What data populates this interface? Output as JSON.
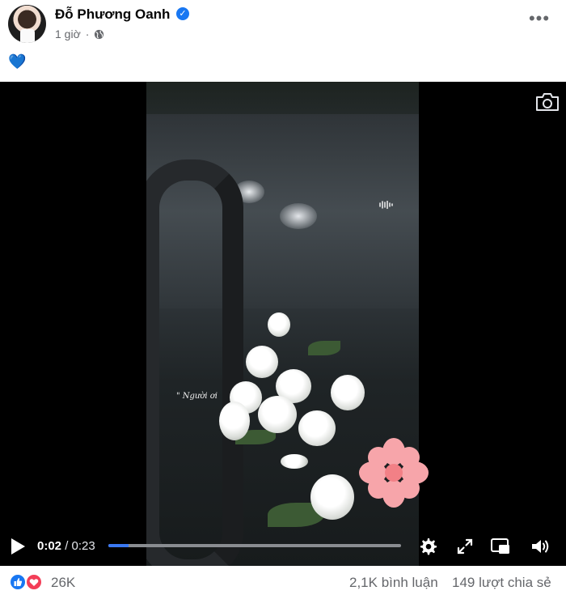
{
  "post": {
    "author": "Đỗ Phương Oanh",
    "time": "1 giờ",
    "text": "💙"
  },
  "video": {
    "overlay_text": "\" Người ơi",
    "current_time": "0:02",
    "separator": "/",
    "duration": "0:23",
    "progress": 0.068
  },
  "footer": {
    "reaction_count": "26K",
    "comments": "2,1K bình luận",
    "shares": "149 lượt chia sẻ"
  },
  "colors": {
    "accent": "#1877f2",
    "progress": "#3a78f2",
    "secondary_text": "#65676b",
    "flower": "#f7a5aa"
  },
  "icons": [
    "verified-badge-icon",
    "globe-icon",
    "more-options-icon",
    "audio-wave-icon",
    "camera-icon",
    "play-icon",
    "gear-icon",
    "fullscreen-icon",
    "picture-in-picture-icon",
    "volume-icon",
    "like-icon",
    "love-icon"
  ]
}
